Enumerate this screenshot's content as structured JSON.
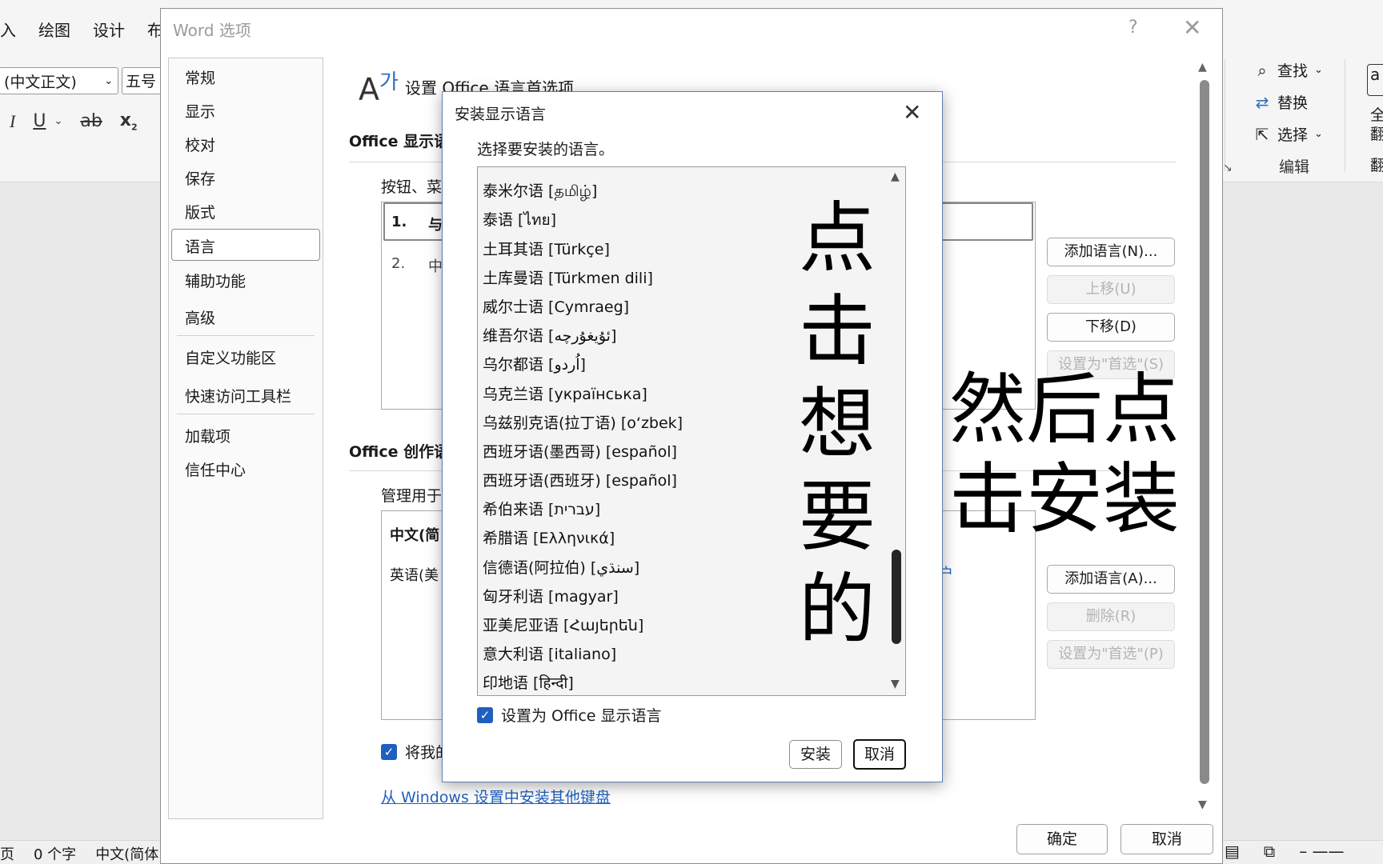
{
  "ribbon": {
    "tabs": [
      "入",
      "绘图",
      "设计",
      "布"
    ],
    "font_name": "(中文正文)",
    "font_size": "五号",
    "format_buttons": [
      "I",
      "U",
      "ab",
      "x"
    ],
    "editing": {
      "find": "查找",
      "replace": "替换",
      "select": "选择",
      "group_label": "编辑",
      "right_partial": [
        "全",
        "翻",
        "翻"
      ]
    }
  },
  "status_bar": {
    "page": "页",
    "words": "0 个字",
    "language": "中文(简体"
  },
  "word_options": {
    "title": "Word 选项",
    "help": "?",
    "nav": [
      "常规",
      "显示",
      "校对",
      "保存",
      "版式",
      "语言",
      "辅助功能",
      "高级",
      "自定义功能区",
      "快速访问工具栏",
      "加载项",
      "信任中心"
    ],
    "selected_nav": "语言",
    "page_title": "设置 Office 语言首选项",
    "display_section": {
      "heading": "Office 显示语",
      "subtitle": "按钮、菜",
      "items": [
        "1.",
        "与",
        "2.",
        "中"
      ],
      "buttons": {
        "add": "添加语言(N)...",
        "up": "上移(U)",
        "down": "下移(D)",
        "preferred": "设置为\"首选\"(S)"
      }
    },
    "authoring_section": {
      "heading": "Office 创作语",
      "subtitle": "管理用于",
      "items": [
        "中文(简",
        "英语(美"
      ],
      "link_fragment": "户",
      "buttons": {
        "add": "添加语言(A)...",
        "remove": "删除(R)",
        "preferred": "设置为\"首选\"(P)"
      }
    },
    "checkbox_label": "将我的",
    "keyboard_link": "从 Windows 设置中安装其他键盘",
    "ok": "确定",
    "cancel": "取消"
  },
  "install_dialog": {
    "title": "安装显示语言",
    "prompt": "选择要安装的语言。",
    "languages": [
      "泰米尔语 [தமிழ்]",
      "泰语 [ไทย]",
      "土耳其语 [Türkçe]",
      "土库曼语 [Türkmen dili]",
      "威尔士语 [Cymraeg]",
      "维吾尔语 [ئۇيغۇرچە]",
      "乌尔都语 [اُردو]",
      "乌克兰语 [українська]",
      "乌兹别克语(拉丁语) [o‘zbek]",
      "西班牙语(墨西哥) [español]",
      "西班牙语(西班牙) [español]",
      "希伯来语 [עברית]",
      "希腊语 [Ελληνικά]",
      "信德语(阿拉伯) [سنڌي]",
      "匈牙利语 [magyar]",
      "亚美尼亚语 [Հայերեն]",
      "意大利语 [italiano]",
      "印地语 [हिन्दी]"
    ],
    "checkbox_label": "设置为 Office 显示语言",
    "checkbox_checked": true,
    "install": "安装",
    "cancel": "取消"
  },
  "annotation": {
    "vertical": [
      "点",
      "击",
      "想",
      "要",
      "的"
    ],
    "horizontal": [
      "然后点",
      "击安装"
    ]
  },
  "colors": {
    "accent": "#1f5fbf",
    "dialog_border": "#5b7fb5"
  }
}
